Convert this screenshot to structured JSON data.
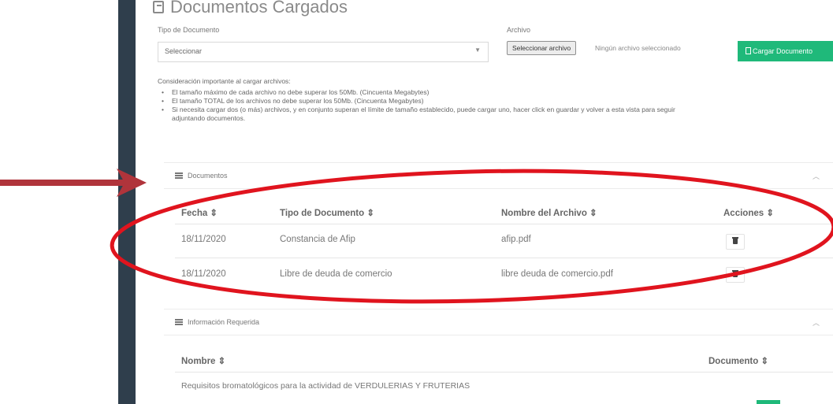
{
  "page": {
    "heading": "Documentos Cargados"
  },
  "form": {
    "doc_type_label": "Tipo de Documento",
    "doc_type_value": "Seleccionar",
    "file_label": "Archivo",
    "file_button": "Seleccionar archivo",
    "file_status": "Ningún archivo seleccionado",
    "upload_button": "Cargar Documento"
  },
  "notes": {
    "title": "Consideración importante al cargar archivos:",
    "items": [
      "El tamaño máximo de cada archivo no debe superar los 50Mb. (Cincuenta Megabytes)",
      "El tamaño TOTAL de los archivos no debe superar los 50Mb. (Cincuenta Megabytes)",
      "Si necesita cargar dos (o más) archivos, y en conjunto superan el límite de tamaño establecido, puede cargar uno, hacer click en guardar y volver a esta vista para seguir",
      "adjuntando documentos."
    ]
  },
  "documents_panel": {
    "title": "Documentos",
    "columns": [
      "Fecha ⇕",
      "Tipo de Documento ⇕",
      "Nombre del Archivo ⇕",
      "Acciones ⇕"
    ],
    "rows": [
      {
        "fecha": "18/11/2020",
        "tipo": "Constancia de Afip",
        "archivo": "afip.pdf"
      },
      {
        "fecha": "18/11/2020",
        "tipo": "Libre de deuda de comercio",
        "archivo": "libre deuda de comercio.pdf"
      }
    ]
  },
  "info_panel": {
    "title": "Información Requerida",
    "columns": [
      "Nombre ⇕",
      "Documento ⇕"
    ],
    "rows": [
      {
        "nombre": "Requisitos bromatológicos para la actividad de VERDULERIAS Y FRUTERIAS"
      }
    ]
  },
  "colors": {
    "sidebar": "#2f3e4c",
    "accent_green": "#1fb97a",
    "annotation_red": "#e0141e",
    "arrow_red": "#b0343b"
  }
}
